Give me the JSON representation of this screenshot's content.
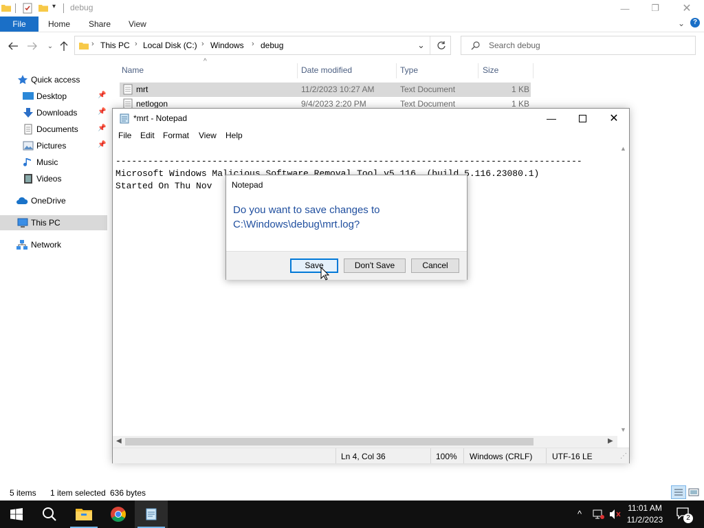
{
  "explorer": {
    "title": "debug",
    "ribbon_tabs": [
      "File",
      "Home",
      "Share",
      "View"
    ],
    "breadcrumb": [
      "This PC",
      "Local Disk (C:)",
      "Windows",
      "debug"
    ],
    "search_placeholder": "Search debug",
    "sidebar": [
      {
        "label": "Quick access",
        "icon": "star-icon"
      },
      {
        "label": "Desktop",
        "icon": "desktop-icon"
      },
      {
        "label": "Downloads",
        "icon": "download-icon"
      },
      {
        "label": "Documents",
        "icon": "documents-icon"
      },
      {
        "label": "Pictures",
        "icon": "pictures-icon"
      },
      {
        "label": "Music",
        "icon": "music-icon"
      },
      {
        "label": "Videos",
        "icon": "videos-icon"
      },
      {
        "label": "OneDrive",
        "icon": "cloud-icon"
      },
      {
        "label": "This PC",
        "icon": "computer-icon"
      },
      {
        "label": "Network",
        "icon": "network-icon"
      }
    ],
    "columns": [
      "Name",
      "Date modified",
      "Type",
      "Size"
    ],
    "files": [
      {
        "name": "mrt",
        "date": "11/2/2023 10:27 AM",
        "type": "Text Document",
        "size": "1 KB"
      },
      {
        "name": "netlogon",
        "date": "9/4/2023 2:20 PM",
        "type": "Text Document",
        "size": "1 KB"
      }
    ],
    "status": {
      "items": "5 items",
      "selected": "1 item selected",
      "bytes": "636 bytes"
    }
  },
  "notepad": {
    "title": "*mrt - Notepad",
    "menu": [
      "File",
      "Edit",
      "Format",
      "View",
      "Help"
    ],
    "lines": [
      "---------------------------------------------------------------------------------------",
      "Microsoft Windows Malicious Software Removal Tool v5.116, (build 5.116.23080.1)",
      "Started On Thu Nov"
    ],
    "status": {
      "position": "Ln 4, Col 36",
      "zoom": "100%",
      "line_ending": "Windows (CRLF)",
      "encoding": "UTF-16 LE"
    }
  },
  "dialog": {
    "title": "Notepad",
    "message_line1": "Do you want to save changes to",
    "message_line2": "C:\\Windows\\debug\\mrt.log?",
    "save_label": "Save",
    "dont_save_label": "Don't Save",
    "cancel_label": "Cancel"
  },
  "taskbar": {
    "time": "11:01 AM",
    "date": "11/2/2023",
    "notification_count": "2"
  },
  "colors": {
    "accent": "#1a6fc7",
    "dialog_text": "#1f4e9e",
    "taskbar": "#101010"
  }
}
